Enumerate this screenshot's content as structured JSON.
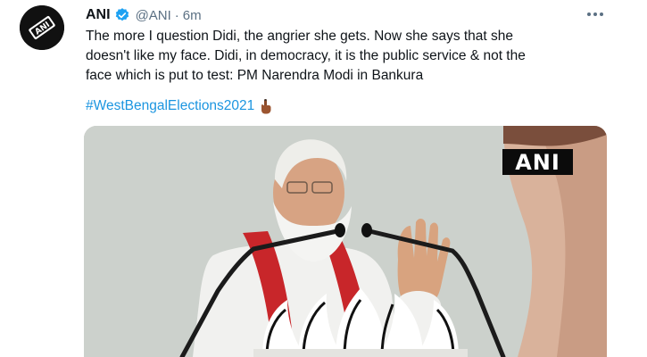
{
  "tweet": {
    "display_name": "ANI",
    "handle": "@ANI",
    "separator": "·",
    "time": "6m",
    "text_lines": [
      "The more I question Didi, the angrier she gets. Now she says that she",
      "doesn't like my face. Didi, in democracy, it is the public service & not the",
      "face which is put to test: PM Narendra Modi in Bankura"
    ],
    "hashtag": "#WestBengalElections2021",
    "media": {
      "watermark": "ANI"
    }
  },
  "icons": {
    "avatar": "ani-logo-icon",
    "verified": "verified-badge-icon",
    "more": "more-icon",
    "hashtag_emoji": "raised-hand-icon"
  },
  "colors": {
    "accent": "#1b95e0",
    "verified": "#1da1f2",
    "secondary_text": "#5b7083",
    "primary_text": "#0f1419"
  }
}
